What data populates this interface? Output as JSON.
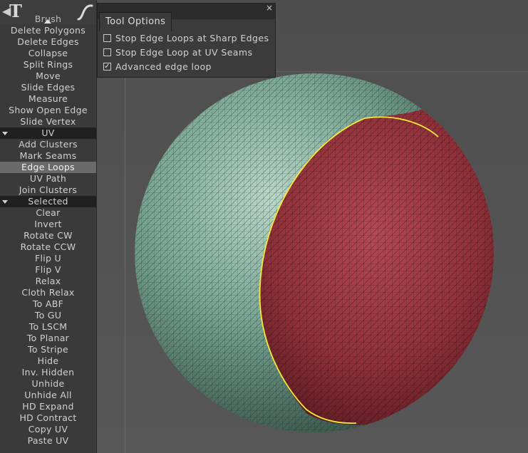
{
  "panel": {
    "partial_top_item": "Brush",
    "items_top": [
      "Delete Polygons",
      "Delete Edges",
      "Collapse",
      "Split Rings",
      "Move",
      "Slide Edges",
      "Measure",
      "Show Open Edge",
      "Slide Vertex"
    ],
    "uv_section": "UV",
    "uv_items": [
      "Add Clusters",
      "Mark Seams",
      "Edge Loops",
      "UV Path",
      "Join Clusters"
    ],
    "active_item": "Edge Loops",
    "selected_section": "Selected",
    "selected_items": [
      "Clear",
      "Invert",
      "Rotate CW",
      "Rotate CCW",
      "Flip U",
      "Flip V",
      "Relax",
      "Cloth Relax",
      "To ABF",
      "To GU",
      "To LSCM",
      "To Planar",
      "To Stripe",
      "Hide",
      "Inv. Hidden",
      "Unhide",
      "Unhide All",
      "HD Expand",
      "HD Contract",
      "Copy UV",
      "Paste UV"
    ]
  },
  "tool_options": {
    "title": "Tool Options",
    "close": "×",
    "options": [
      {
        "label": "Stop Edge Loops at Sharp Edges",
        "checked": false
      },
      {
        "label": "Stop Edge Loop at UV Seams",
        "checked": false
      },
      {
        "label": "Advanced edge loop",
        "checked": true
      }
    ]
  },
  "icons": {
    "top_left": [
      "nav-left-icon",
      "text-tool-icon",
      "scroll-up-icon",
      "curve-tool-icon"
    ]
  },
  "colors": {
    "panel_bg": "#3a3a3a",
    "section_bg": "#202020",
    "active_item_bg": "#6a6a6a",
    "mesh_green": "#6f9c8a",
    "mesh_red": "#9a3a42",
    "seam_yellow": "#f2ea3c",
    "viewport_bg": "#525252"
  }
}
